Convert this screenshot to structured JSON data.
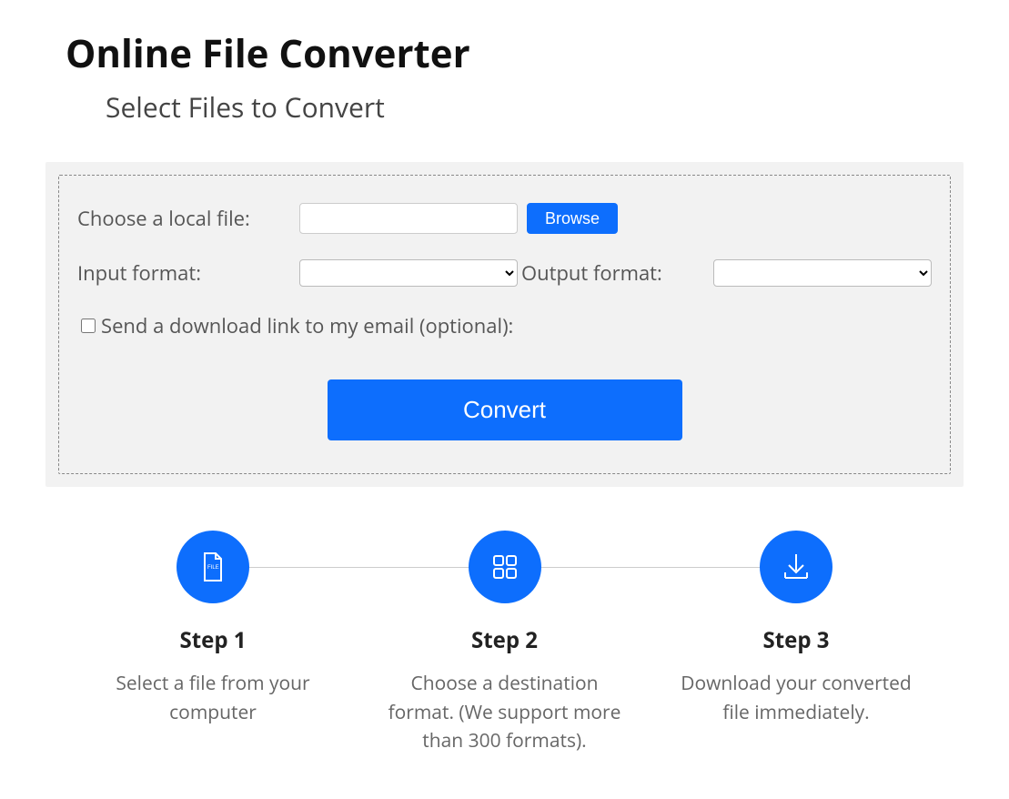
{
  "header": {
    "title": "Online File Converter",
    "subtitle": "Select Files to Convert"
  },
  "form": {
    "choose_label": "Choose a local file:",
    "file_value": "",
    "browse_label": "Browse",
    "input_format_label": "Input format:",
    "input_format_value": "",
    "output_format_label": "Output format:",
    "output_format_value": "",
    "email_checkbox_label": "Send a download link to my email (optional):",
    "email_checkbox_checked": false,
    "convert_label": "Convert"
  },
  "steps": [
    {
      "icon": "file-icon",
      "title": "Step 1",
      "desc": "Select a file from your computer"
    },
    {
      "icon": "grid-icon",
      "title": "Step 2",
      "desc": "Choose a destination format. (We support more than 300 formats)."
    },
    {
      "icon": "download-icon",
      "title": "Step 3",
      "desc": "Download your converted file immediately."
    }
  ],
  "colors": {
    "primary": "#0d6efd",
    "panel_bg": "#f2f2f2",
    "text_muted": "#555"
  }
}
